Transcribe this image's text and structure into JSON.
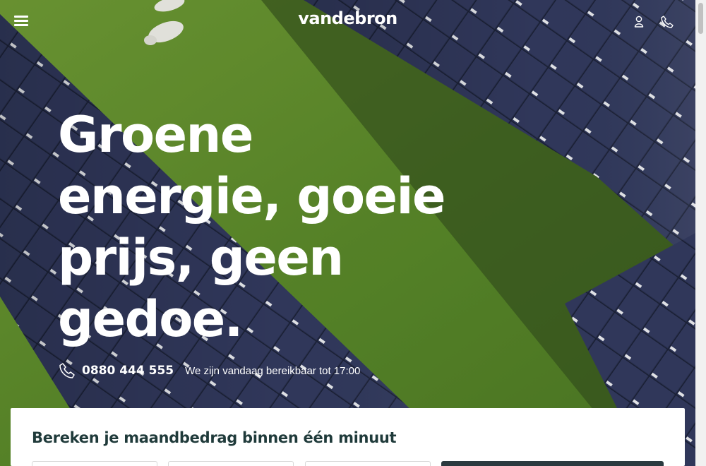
{
  "brand": {
    "name": "vandebron"
  },
  "header": {
    "menu_icon": "hamburger-menu-icon",
    "account_icon": "user-icon",
    "phone_icon": "phone-icon"
  },
  "hero": {
    "headline": "Groene energie, goeie prijs, geen gedoe.",
    "contact": {
      "phone_icon": "phone-icon",
      "phone_number": "0880 444 555",
      "availability": "We zijn vandaag bereikbaar tot 17:00"
    },
    "background": "solar-panels-in-grass-field-with-sheep"
  },
  "calculator": {
    "title": "Bereken je maandbedrag binnen één minuut"
  },
  "colors": {
    "text_light": "#ffffff",
    "card_title": "#1f3a3a",
    "button_dark": "#2b3a3f",
    "grass": "#5d8a2c",
    "panel": "#2c3354"
  }
}
